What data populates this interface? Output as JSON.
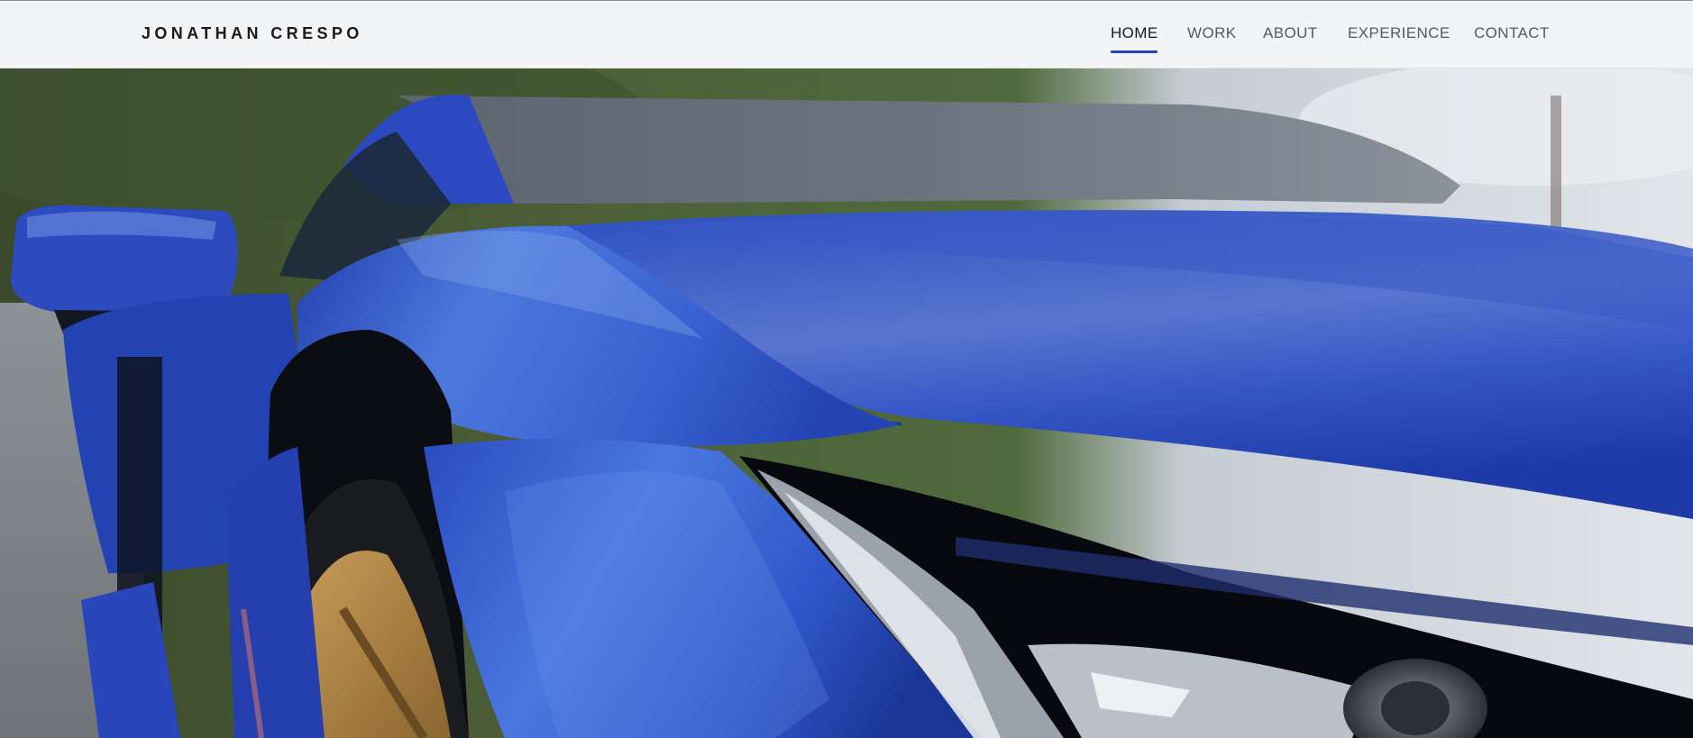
{
  "site": {
    "brand": "JONATHAN CRESPO"
  },
  "nav": {
    "items": [
      {
        "label": "HOME",
        "active": true
      },
      {
        "label": "WORK",
        "active": false
      },
      {
        "label": "ABOUT",
        "active": false
      },
      {
        "label": "EXPERIENCE",
        "active": false
      },
      {
        "label": "CONTACT",
        "active": false
      }
    ]
  },
  "hero": {
    "image": "blue-sports-car-photo"
  },
  "colors": {
    "accent": "#2148b3",
    "navbar_bg": "#f3f4f6",
    "car_blue": "#2f57c8"
  }
}
